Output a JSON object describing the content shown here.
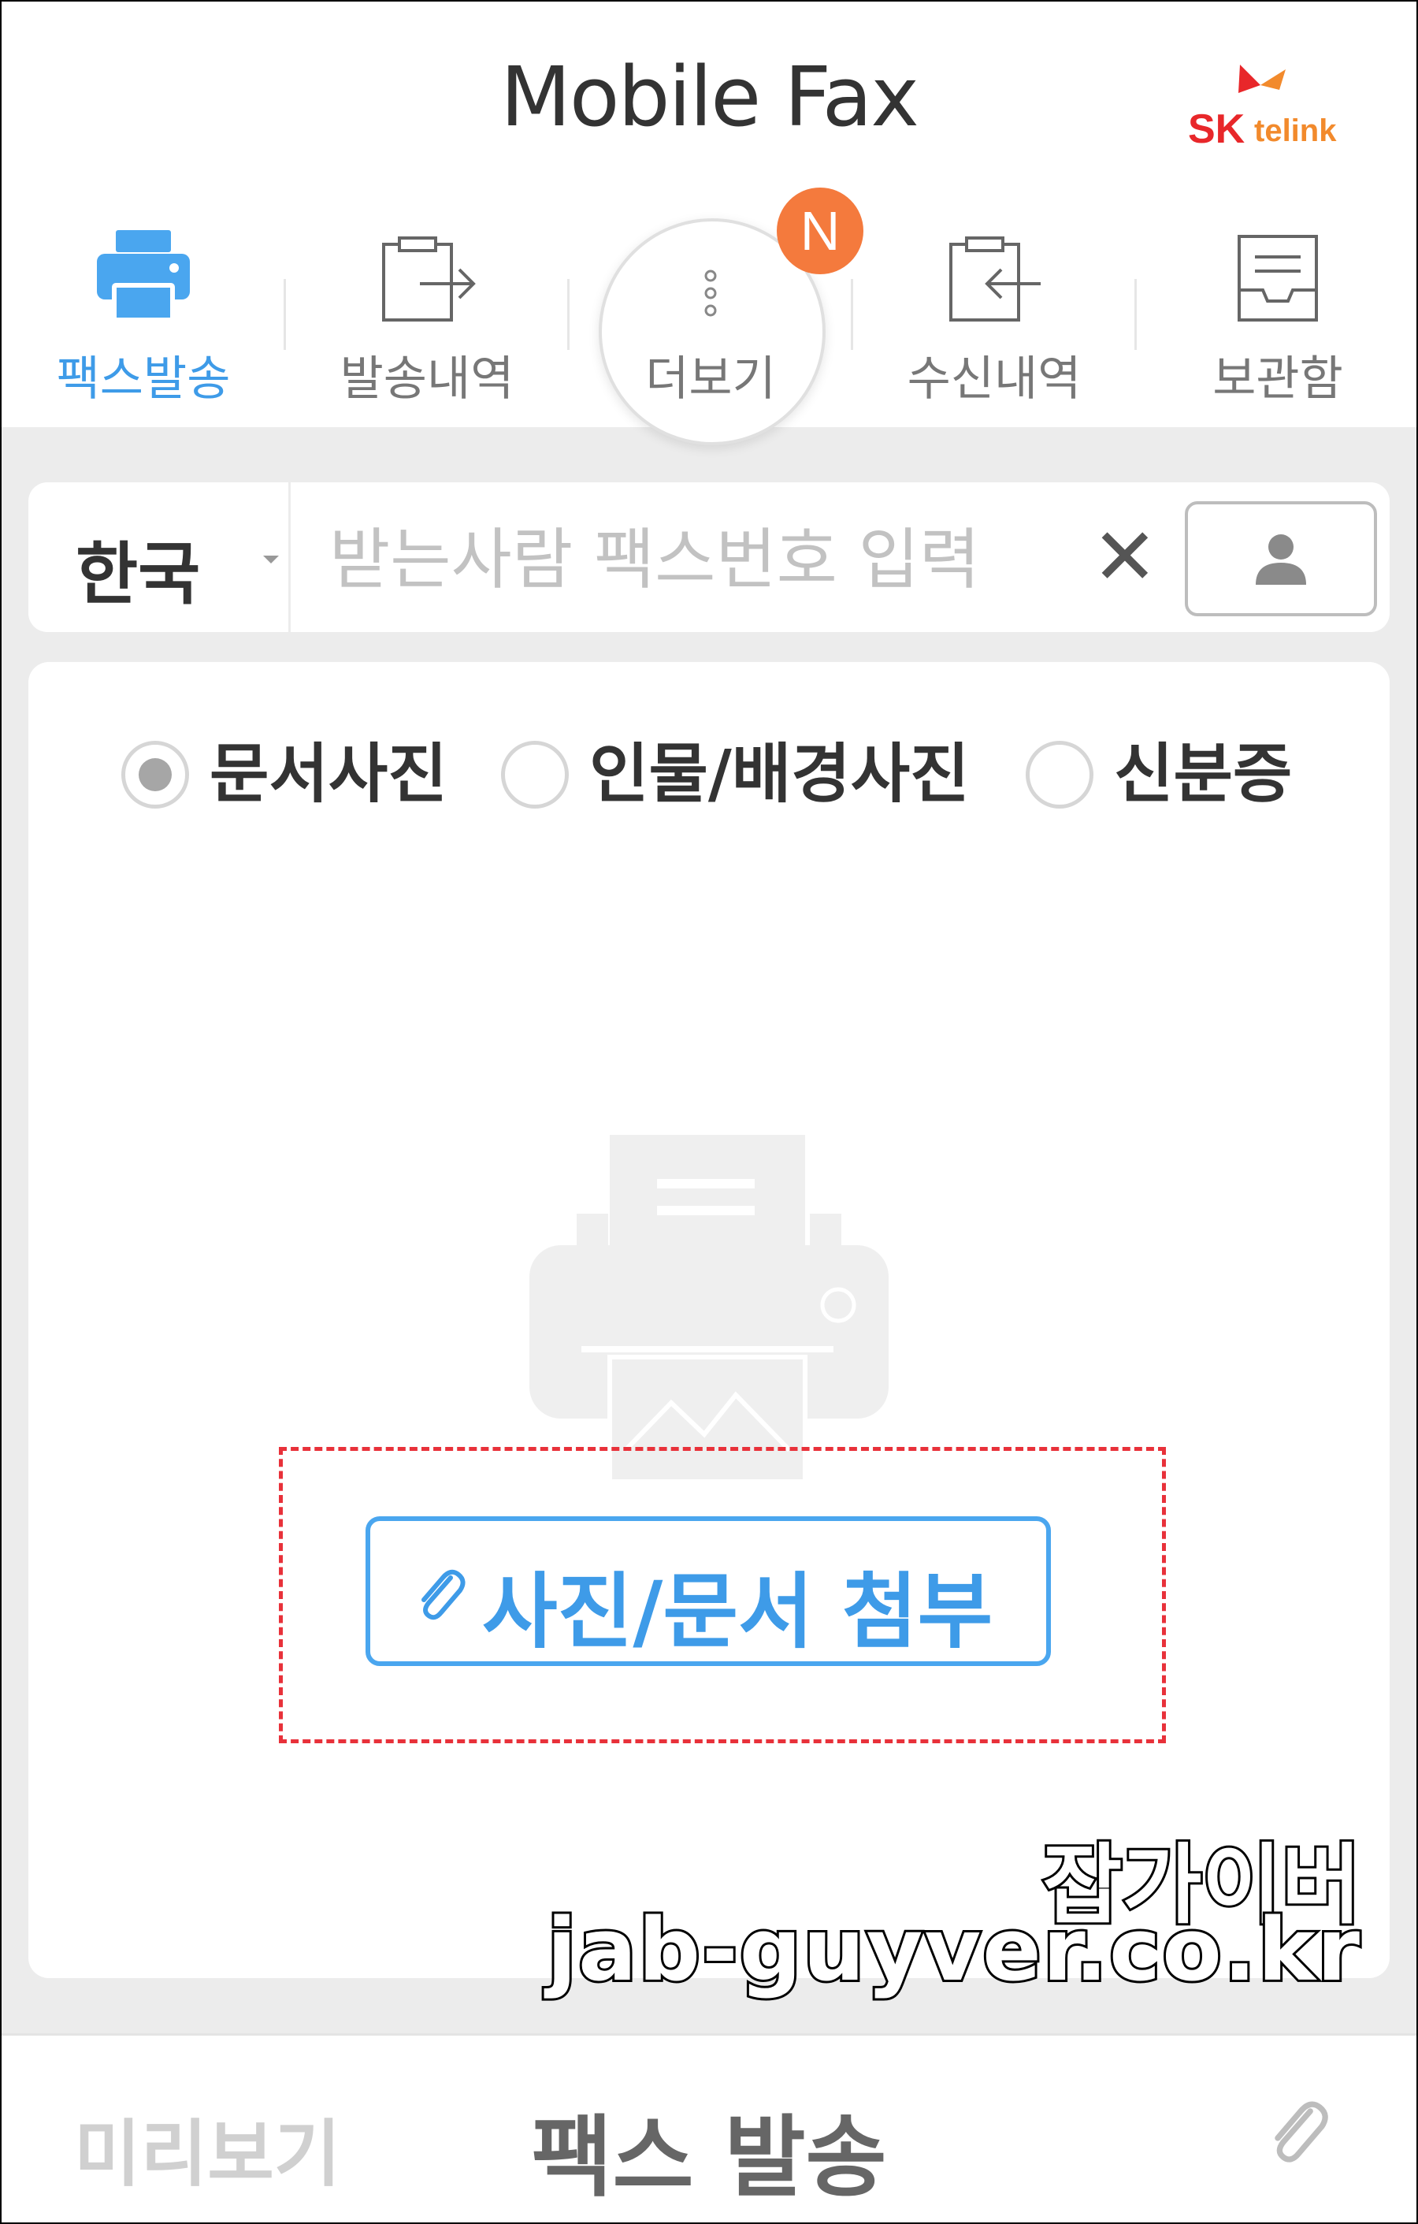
{
  "app": {
    "title": "Mobile Fax",
    "brand_logo": {
      "sk": "SK",
      "telink": "telink"
    }
  },
  "nav": {
    "items": [
      {
        "label": "팩스발송",
        "icon": "printer-icon",
        "active": true
      },
      {
        "label": "발송내역",
        "icon": "send-history-icon",
        "active": false
      },
      {
        "label": "더보기",
        "icon": "more-vertical-icon",
        "active": false
      },
      {
        "label": "수신내역",
        "icon": "receive-history-icon",
        "active": false
      },
      {
        "label": "보관함",
        "icon": "archive-tray-icon",
        "active": false
      }
    ],
    "badge": "N"
  },
  "recipient": {
    "country": "한국",
    "placeholder": "받는사람 팩스번호 입력",
    "value": "",
    "clear_label": "✕"
  },
  "doc_type": {
    "options": [
      {
        "label": "문서사진",
        "selected": true
      },
      {
        "label": "인물/배경사진",
        "selected": false
      },
      {
        "label": "신분증",
        "selected": false
      }
    ]
  },
  "attach": {
    "label": "사진/문서 첨부",
    "icon": "paperclip-icon"
  },
  "watermark": {
    "line1": "잡가이버",
    "line2": "jab-guyver.co.kr"
  },
  "bottom": {
    "preview_label": "미리보기",
    "send_label": "팩스 발송"
  },
  "colors": {
    "accent": "#3e9be8",
    "badge": "#f47a3d",
    "highlight": "#e8313a"
  }
}
